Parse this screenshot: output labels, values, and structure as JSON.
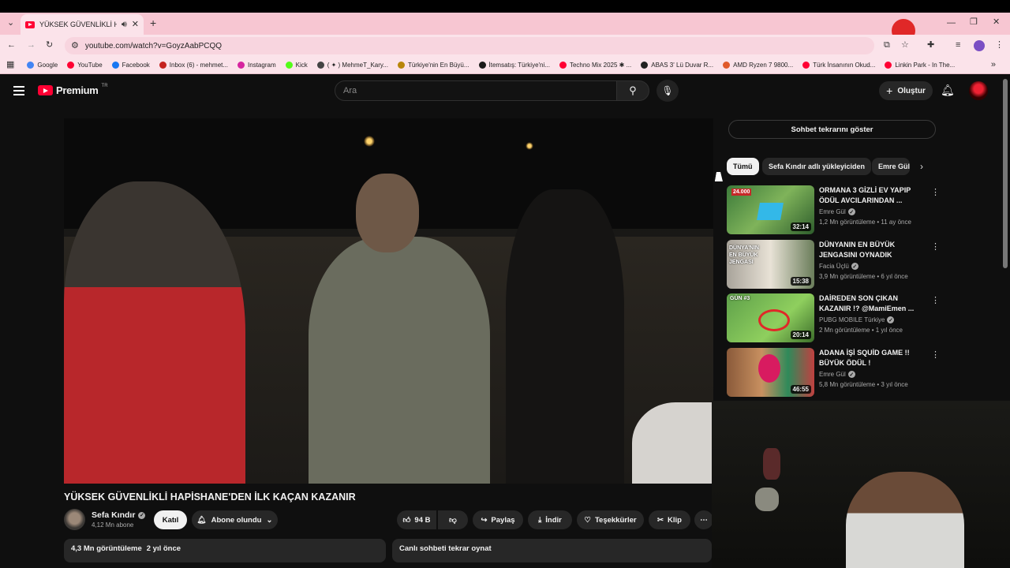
{
  "browser": {
    "tab_title": "YÜKSEK GÜVENLİKLİ HAPİS",
    "url": "youtube.com/watch?v=GoyzAabPCQQ",
    "bookmarks": [
      {
        "label": "Google",
        "color": "#4285f4"
      },
      {
        "label": "YouTube",
        "color": "#ff0033"
      },
      {
        "label": "Facebook",
        "color": "#1877f2"
      },
      {
        "label": "Inbox (6) - mehmet...",
        "color": "#c5221f"
      },
      {
        "label": "Instagram",
        "color": "#d6249f"
      },
      {
        "label": "Kick",
        "color": "#53fc18"
      },
      {
        "label": "( ✦ ) MehmeT_Kary...",
        "color": "#444444"
      },
      {
        "label": "Türkiye'nin En Büyü...",
        "color": "#b8860b"
      },
      {
        "label": "İtemsatış: Türkiye'ni...",
        "color": "#1a1a1a"
      },
      {
        "label": "Techno Mix 2025 ✱ ...",
        "color": "#ff0033"
      },
      {
        "label": "ABAS 3' Lü Duvar R...",
        "color": "#222222"
      },
      {
        "label": "AMD Ryzen 7 9800...",
        "color": "#e05a2b"
      },
      {
        "label": "Türk İnsanının Okud...",
        "color": "#ff0033"
      },
      {
        "label": "Linkin Park - In The...",
        "color": "#ff0033"
      }
    ]
  },
  "yt": {
    "logo_text": "Premium",
    "region": "TR",
    "search_placeholder": "Ara",
    "create_label": "Oluştur"
  },
  "video": {
    "title": "YÜKSEK GÜVENLİKLİ HAPİSHANE'DEN İLK KAÇAN KAZANIR",
    "channel": "Sefa Kındır",
    "subscribers": "4,12 Mn abone",
    "join_label": "Katıl",
    "subscribed_label": "Abone olundu",
    "likes": "94 B",
    "share_label": "Paylaş",
    "download_label": "İndir",
    "thanks_label": "Teşekkürler",
    "clip_label": "Klip",
    "views": "4,3 Mn görüntüleme",
    "age": "2 yıl önce",
    "live_chat_label": "Canlı sohbeti tekrar oynat"
  },
  "sidebar": {
    "chat_replay_label": "Sohbet tekrarını göster",
    "chips": [
      "Tümü",
      "Sefa Kındır adlı yükleyiciden",
      "Emre Gül"
    ],
    "recommendations": [
      {
        "title": "ORMANA 3 GİZLİ EV YAPIP ÖDÜL AVCILARINDAN ...",
        "channel": "Emre Gül",
        "meta": "1,2 Mn görüntüleme • 11 ay önce",
        "duration": "32:14",
        "thumb_text": "24.000"
      },
      {
        "title": "DÜNYANIN EN BÜYÜK JENGASINI OYNADIK",
        "channel": "Facia Üçlü",
        "meta": "3,9 Mn görüntüleme • 6 yıl önce",
        "duration": "15:38",
        "thumb_text": "DÜNYA'NIN EN BÜYÜK JENGASI"
      },
      {
        "title": "DAİREDEN SON ÇIKAN KAZANIR !? @MamiEmen ...",
        "channel": "PUBG MOBILE Türkiye",
        "meta": "2 Mn görüntüleme • 1 yıl önce",
        "duration": "20:14",
        "thumb_text": "GÜN #3"
      },
      {
        "title": "ADANA İŞİ SQUİD GAME !! BÜYÜK ÖDÜL !",
        "channel": "Emre Gül",
        "meta": "5,8 Mn görüntüleme • 3 yıl önce",
        "duration": "46:55",
        "thumb_text": ""
      }
    ]
  }
}
